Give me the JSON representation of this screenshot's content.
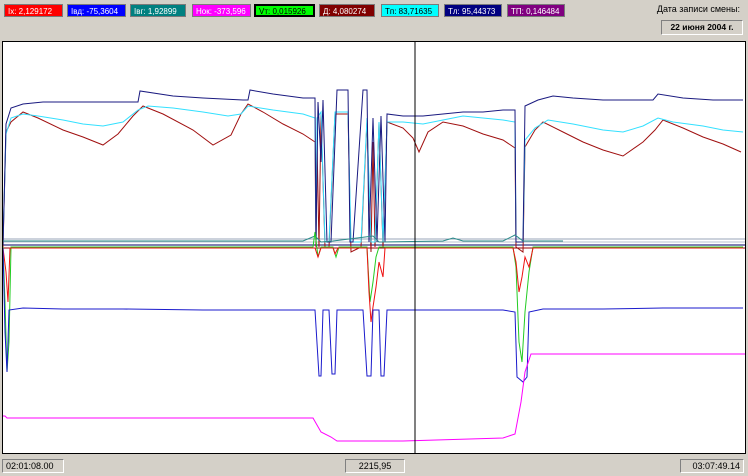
{
  "channels": [
    {
      "label": "Ix: 2,129172",
      "bg": "#ff0000",
      "fg": "#ffffff"
    },
    {
      "label": "Iвд: -75,3604",
      "bg": "#0000ff",
      "fg": "#ffffff"
    },
    {
      "label": "Iвг: 1,92899",
      "bg": "#008080",
      "fg": "#ffffff"
    },
    {
      "label": "Hок: -373,596",
      "bg": "#ff00ff",
      "fg": "#ffffff"
    },
    {
      "label": "Vт: 0,015926",
      "bg": "#00ff00",
      "fg": "#000000"
    },
    {
      "label": "Д: 4,080274",
      "bg": "#800000",
      "fg": "#ffffff"
    },
    {
      "label": "Tп: 83,71635",
      "bg": "#00ffff",
      "fg": "#000000"
    },
    {
      "label": "Tл: 95,44373",
      "bg": "#000080",
      "fg": "#ffffff"
    },
    {
      "label": "TП: 0,146484",
      "bg": "#800080",
      "fg": "#ffffff"
    }
  ],
  "header": {
    "date_caption": "Дата записи смены:",
    "date_value": "22 июня 2004 г."
  },
  "status": {
    "start_time": "02:01:08.00",
    "cursor_value": "2215,95",
    "end_time": "03:07:49.14"
  },
  "colors": {
    "plot_bg": "#ffffff",
    "window_bg": "#d4d0c8",
    "cursor": "#000000"
  }
}
